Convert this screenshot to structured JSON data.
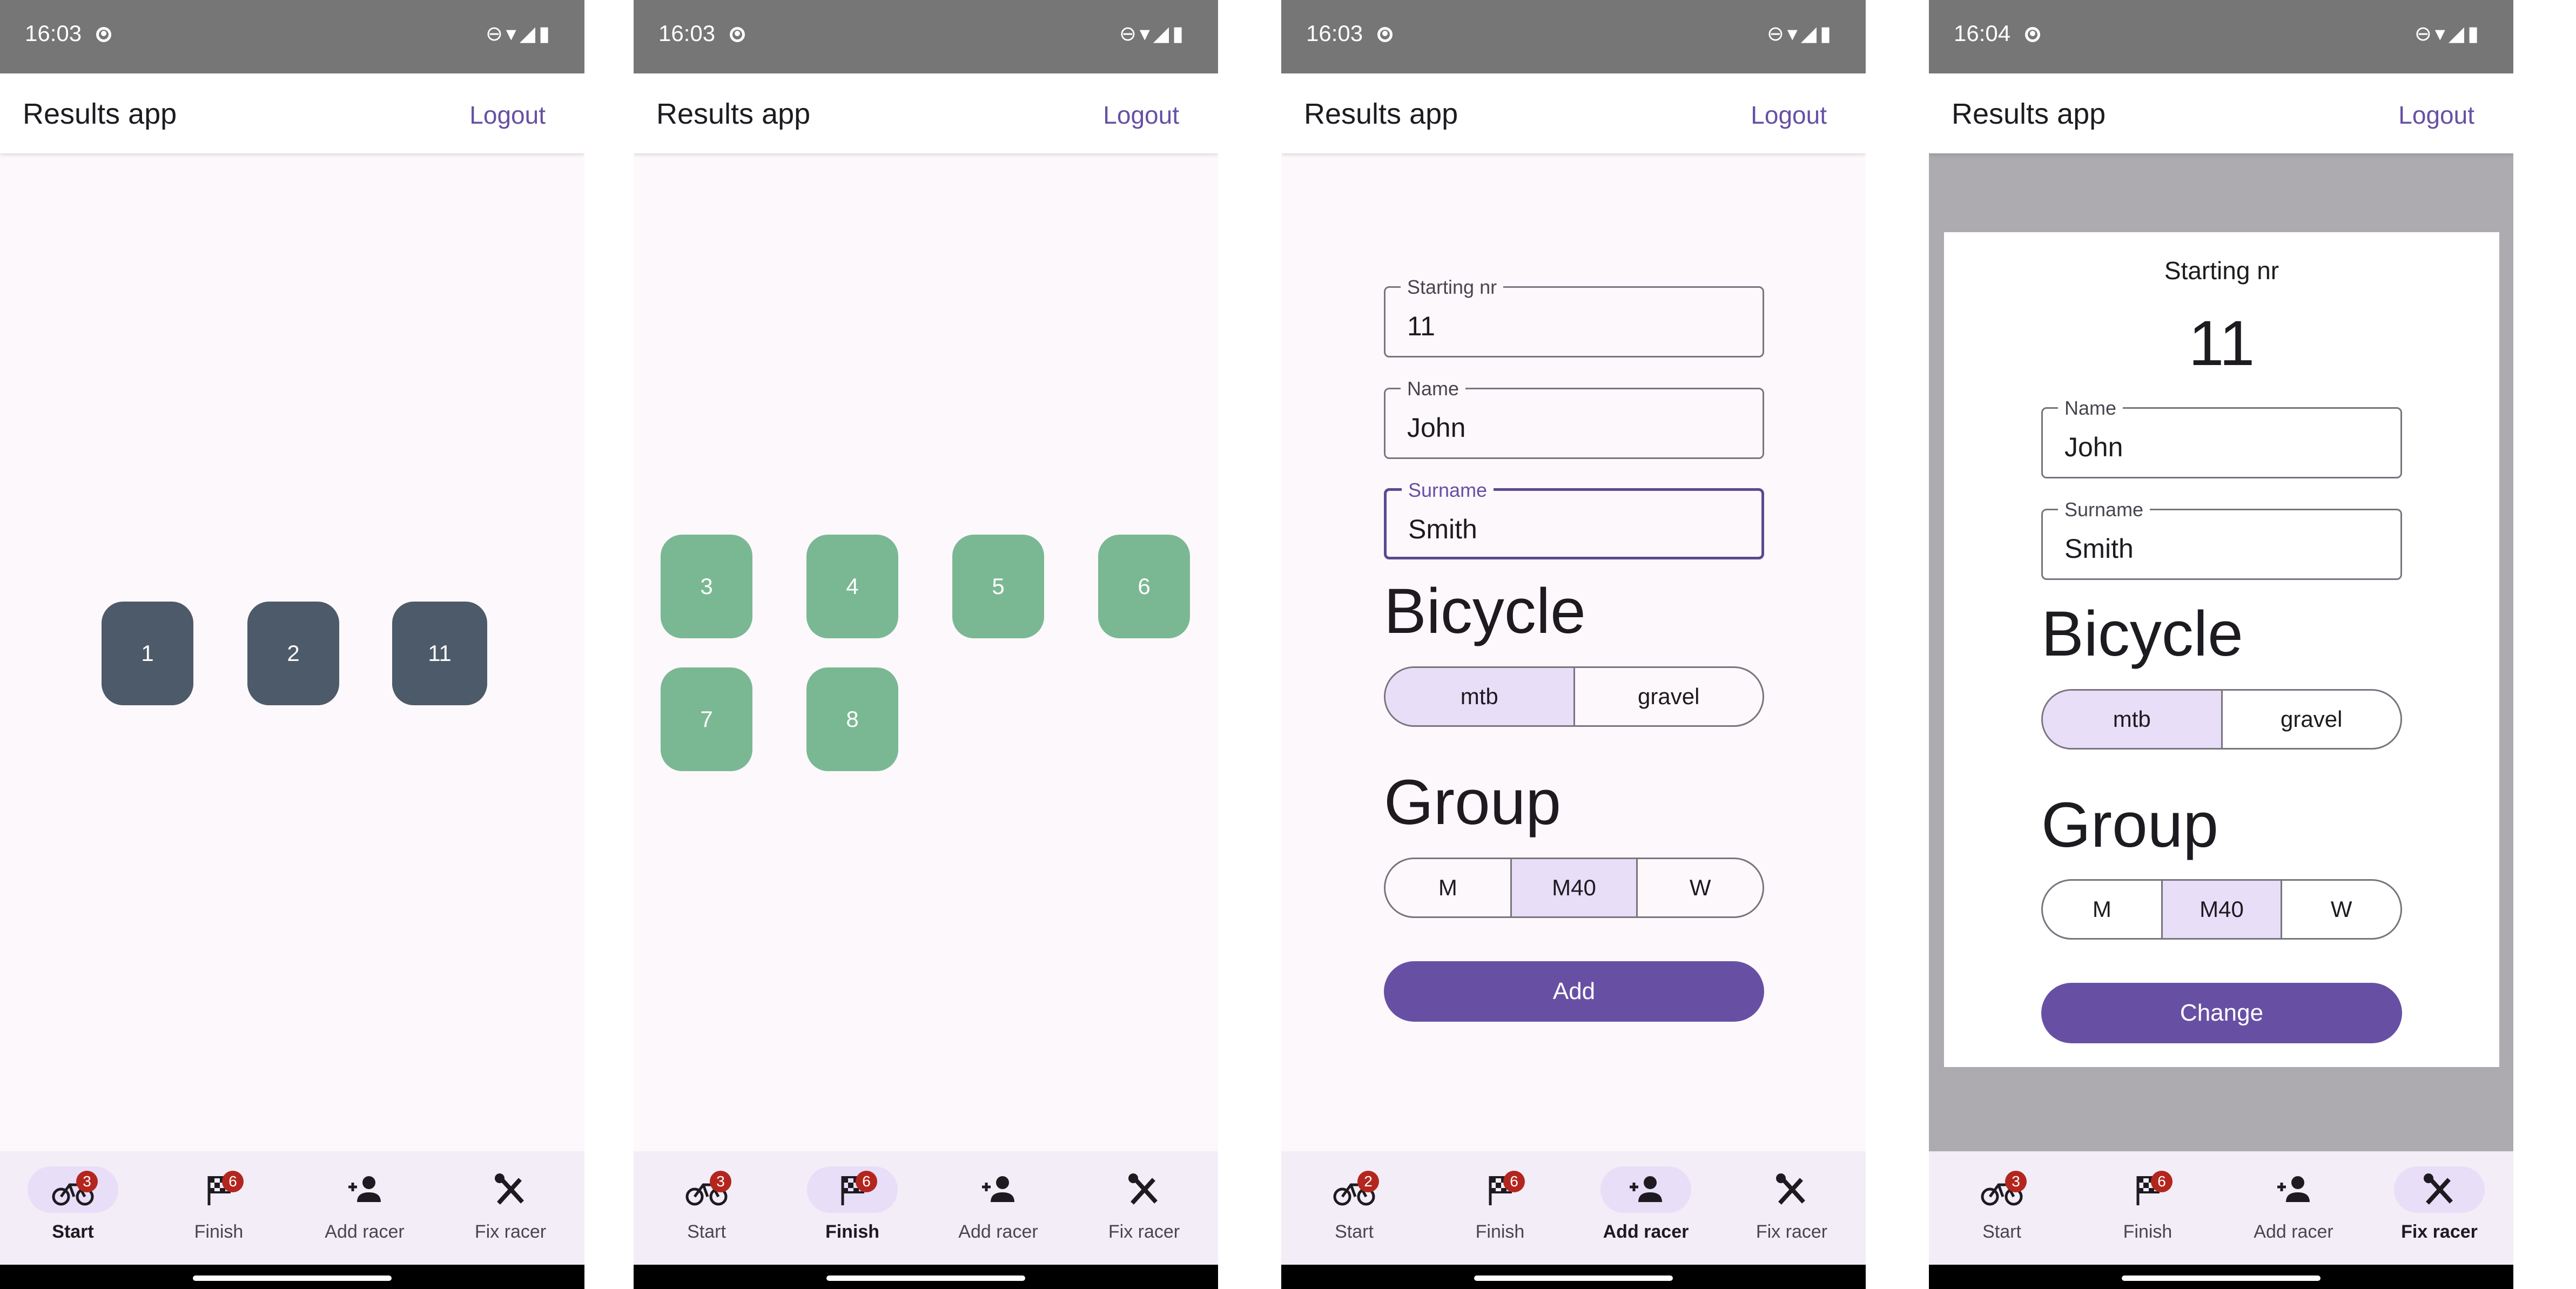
{
  "status_time_1": "16:03",
  "status_time_4": "16:04",
  "app_title": "Results app",
  "logout_label": "Logout",
  "start_racers": [
    "1",
    "2",
    "11"
  ],
  "finish_racers": [
    "3",
    "4",
    "5",
    "6",
    "7",
    "8"
  ],
  "add_form": {
    "starting_nr_label": "Starting nr",
    "starting_nr_value": "11",
    "name_label": "Name",
    "name_value": "John",
    "surname_label": "Surname",
    "surname_value": "Smith",
    "bicycle_heading": "Bicycle",
    "bicycle_options": [
      "mtb",
      "gravel"
    ],
    "bicycle_selected": "mtb",
    "group_heading": "Group",
    "group_options": [
      "M",
      "M40",
      "W"
    ],
    "group_selected": "M40",
    "add_button": "Add"
  },
  "fix_dialog": {
    "title": "Starting nr",
    "number": "11",
    "name_label": "Name",
    "name_value": "John",
    "surname_label": "Surname",
    "surname_value": "Smith",
    "bicycle_heading": "Bicycle",
    "bicycle_options": [
      "mtb",
      "gravel"
    ],
    "group_heading": "Group",
    "group_options": [
      "M",
      "M40",
      "W"
    ],
    "change_button": "Change"
  },
  "nav_labels": [
    "Start",
    "Finish",
    "Add racer",
    "Fix racer"
  ],
  "nav_badges": {
    "screen1": [
      "3",
      "6"
    ],
    "screen2": [
      "3",
      "6"
    ],
    "screen3": [
      "2",
      "6"
    ],
    "screen4": [
      "3",
      "6"
    ]
  },
  "icons": {
    "status": [
      "data-saver-icon",
      "dnd-icon",
      "wifi-icon",
      "signal-icon",
      "battery-icon"
    ],
    "nav": [
      "bike-icon",
      "checkered-flag-icon",
      "person-add-icon",
      "tools-icon"
    ]
  },
  "colors": {
    "primary": "#6750a4",
    "selected_container": "#e8def8",
    "start_chip": "#4d5a69",
    "finish_chip": "#7ab893",
    "badge": "#b3261e",
    "status_bar": "#767676"
  }
}
